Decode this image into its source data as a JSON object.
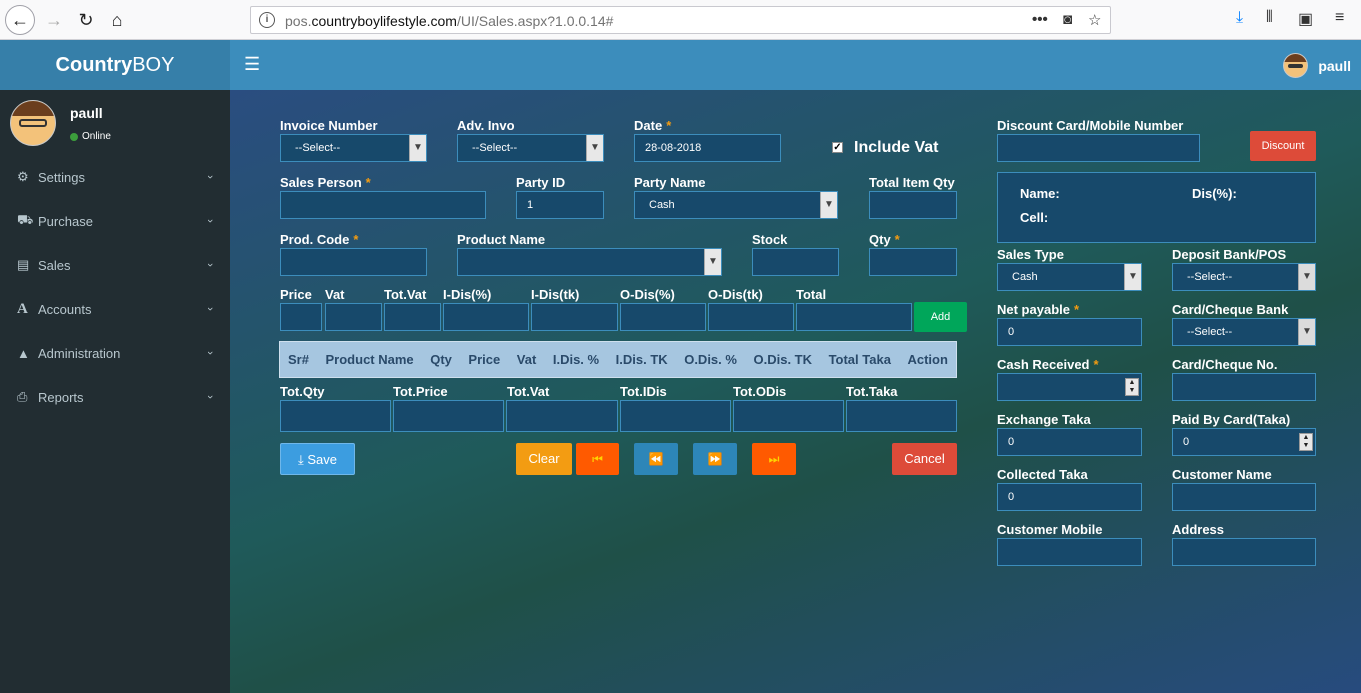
{
  "browser": {
    "url_prefix": "pos.",
    "url_domain": "countryboylifestyle.com",
    "url_path": "/UI/Sales.aspx?1.0.0.14#"
  },
  "app": {
    "logo_bold": "Country",
    "logo_rest": "BOY",
    "topbar_user": "paull"
  },
  "sidebar": {
    "user_name": "paull",
    "status": "Online",
    "items": [
      {
        "label": "Settings",
        "icon": "gears-icon"
      },
      {
        "label": "Purchase",
        "icon": "cart-icon"
      },
      {
        "label": "Sales",
        "icon": "briefcase-icon"
      },
      {
        "label": "Accounts",
        "icon": "font-icon"
      },
      {
        "label": "Administration",
        "icon": "graduation-cap-icon"
      },
      {
        "label": "Reports",
        "icon": "print-icon"
      }
    ]
  },
  "form": {
    "invoice_number_label": "Invoice Number",
    "invoice_number_value": "--Select--",
    "adv_invo_label": "Adv. Invo",
    "adv_invo_value": "--Select--",
    "date_label": "Date",
    "date_value": "28-08-2018",
    "include_vat_label": "Include Vat",
    "sales_person_label": "Sales Person",
    "party_id_label": "Party ID",
    "party_id_value": "1",
    "party_name_label": "Party Name",
    "party_name_value": "Cash",
    "total_item_qty_label": "Total Item Qty",
    "prod_code_label": "Prod. Code",
    "product_name_label": "Product Name",
    "stock_label": "Stock",
    "qty_label": "Qty",
    "price_label": "Price",
    "vat_label": "Vat",
    "tot_vat_label": "Tot.Vat",
    "idis_pct_label": "I-Dis(%)",
    "idis_tk_label": "I-Dis(tk)",
    "odis_pct_label": "O-Dis(%)",
    "odis_tk_label": "O-Dis(tk)",
    "total_label": "Total",
    "add_button": "Add",
    "required_mark": "*"
  },
  "table": {
    "columns": [
      "Sr#",
      "Product Name",
      "Qty",
      "Price",
      "Vat",
      "I.Dis. %",
      "I.Dis. TK",
      "O.Dis. %",
      "O.Dis. TK",
      "Total Taka",
      "Action"
    ]
  },
  "totals": {
    "tot_qty": "Tot.Qty",
    "tot_price": "Tot.Price",
    "tot_vat": "Tot.Vat",
    "tot_idis": "Tot.IDis",
    "tot_odis": "Tot.ODis",
    "tot_taka": "Tot.Taka"
  },
  "actions": {
    "save": "Save",
    "clear": "Clear",
    "cancel": "Cancel",
    "first_icon": "⏮",
    "prev_icon": "⏪",
    "next_icon": "⏩",
    "last_icon": "⏭"
  },
  "right": {
    "discount_card_label": "Discount Card/Mobile Number",
    "discount_button": "Discount",
    "name_label": "Name:",
    "dis_label": "Dis(%):",
    "cell_label": "Cell:",
    "sales_type_label": "Sales Type",
    "sales_type_value": "Cash",
    "deposit_bank_label": "Deposit Bank/POS",
    "deposit_bank_value": "--Select--",
    "net_payable_label": "Net payable",
    "net_payable_value": "0",
    "card_cheque_bank_label": "Card/Cheque Bank",
    "card_cheque_bank_value": "--Select--",
    "cash_received_label": "Cash Received",
    "card_cheque_no_label": "Card/Cheque No.",
    "exchange_taka_label": "Exchange Taka",
    "exchange_taka_value": "0",
    "paid_by_card_label": "Paid By Card(Taka)",
    "paid_by_card_value": "0",
    "collected_taka_label": "Collected Taka",
    "collected_taka_value": "0",
    "customer_name_label": "Customer Name",
    "customer_mobile_label": "Customer Mobile",
    "address_label": "Address"
  },
  "colors": {
    "topbar": "#3c8dbc",
    "sidebar": "#222d32",
    "add": "#00a65a",
    "save": "#3c9de0",
    "clear": "#f39c12",
    "nav_orange": "#ff5a00",
    "nav_blue": "#2d86b8",
    "cancel": "#dd4b39"
  }
}
